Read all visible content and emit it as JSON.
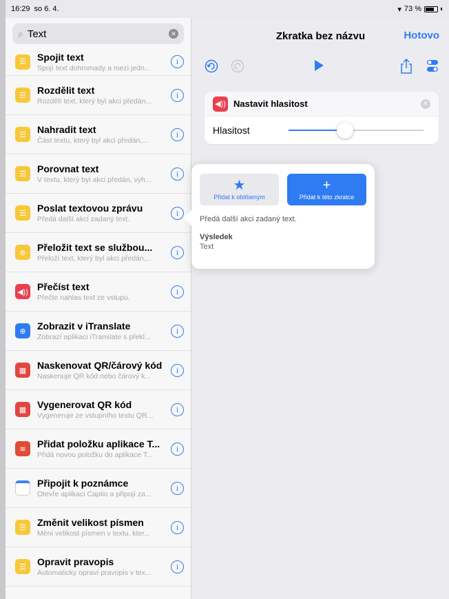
{
  "status": {
    "time": "16:29",
    "date": "so 6. 4.",
    "battery": "73 %",
    "battery_level": 0.73
  },
  "search": {
    "value": "Text"
  },
  "list": [
    {
      "title": "Spojit text",
      "subtitle": "Spojí text dohromady a mezi jedn...",
      "icon": "doc-icon",
      "color": "yellow"
    },
    {
      "title": "Rozdělit text",
      "subtitle": "Rozdělí text, který byl akci předán...",
      "icon": "doc-icon",
      "color": "yellow"
    },
    {
      "title": "Nahradit text",
      "subtitle": "Část textu, který byl akci předán,...",
      "icon": "doc-icon",
      "color": "yellow"
    },
    {
      "title": "Porovnat text",
      "subtitle": "V textu, který byl akci předán, vyh...",
      "icon": "doc-icon",
      "color": "yellow"
    },
    {
      "title": "Poslat textovou zprávu",
      "subtitle": "Předá další akci zadaný text.",
      "icon": "doc-icon",
      "color": "yellow"
    },
    {
      "title": "Přeložit text se službou...",
      "subtitle": "Přeloží text, který byl akci předán,...",
      "icon": "globe-icon",
      "color": "yellow"
    },
    {
      "title": "Přečíst text",
      "subtitle": "Přečte nahlas text ze vstupu.",
      "icon": "speaker-icon",
      "color": "red"
    },
    {
      "title": "Zobrazit v iTranslate",
      "subtitle": "Zobrazí aplikaci iTranslate s překl...",
      "icon": "globe-icon",
      "color": "blue"
    },
    {
      "title": "Naskenovat QR/čárový kód",
      "subtitle": "Naskenuje QR kód nebo čárový k...",
      "icon": "qr-icon",
      "color": "qr"
    },
    {
      "title": "Vygenerovat QR kód",
      "subtitle": "Vygeneruje ze vstupního textu QR...",
      "icon": "qr-icon",
      "color": "qr"
    },
    {
      "title": "Přidat položku aplikace T...",
      "subtitle": "Přidá novou položku do aplikace T...",
      "icon": "todoist-icon",
      "color": "todo"
    },
    {
      "title": "Připojit k poznámce",
      "subtitle": "Otevře aplikaci Captio a připojí za...",
      "icon": "note-icon",
      "color": "note"
    },
    {
      "title": "Změnit velikost písmen",
      "subtitle": "Mění velikost písmen v textu, kter...",
      "icon": "doc-icon",
      "color": "yellow"
    },
    {
      "title": "Opravit pravopis",
      "subtitle": "Automaticky opraví pravopis v tex...",
      "icon": "doc-icon",
      "color": "yellow"
    }
  ],
  "nav": {
    "title": "Zkratka bez názvu",
    "done": "Hotovo"
  },
  "action": {
    "title": "Nastavit hlasitost",
    "param_label": "Hlasitost",
    "volume_level": 0.4
  },
  "popover": {
    "fav_label": "Přidat k oblíbeným",
    "add_label": "Přidat k této zkratce",
    "description": "Předá další akci zadaný text.",
    "result_label": "Výsledek",
    "result_value": "Text"
  },
  "colors": {
    "accent": "#2f7bf2",
    "text_icon": "#f8c83a",
    "speaker": "#e8404f"
  }
}
